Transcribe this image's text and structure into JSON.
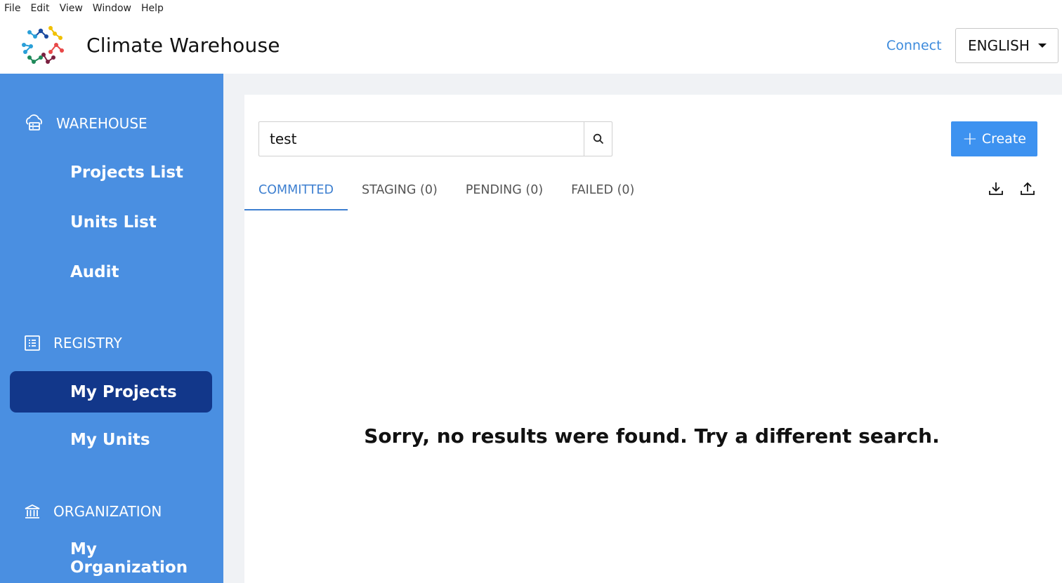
{
  "menubar": {
    "file": "File",
    "edit": "Edit",
    "view": "View",
    "window": "Window",
    "help": "Help"
  },
  "header": {
    "title": "Climate Warehouse",
    "connect_label": "Connect",
    "language": "ENGLISH"
  },
  "sidebar": {
    "warehouse": {
      "label": "WAREHOUSE",
      "items": [
        "Projects List",
        "Units List",
        "Audit"
      ]
    },
    "registry": {
      "label": "REGISTRY",
      "items": [
        "My Projects",
        "My Units"
      ],
      "active": "My Projects"
    },
    "organization": {
      "label": "ORGANIZATION",
      "items": [
        "My Organization"
      ]
    }
  },
  "main": {
    "search_value": "test",
    "create_label": "Create",
    "tabs": [
      {
        "label": "COMMITTED",
        "active": true
      },
      {
        "label": "STAGING (0)",
        "active": false
      },
      {
        "label": "PENDING (0)",
        "active": false
      },
      {
        "label": "FAILED (0)",
        "active": false
      }
    ],
    "empty_message": "Sorry, no results were found. Try a different search."
  },
  "colors": {
    "sidebar": "#4a8fe1",
    "sidebar_active": "#12378a",
    "accent": "#3d92f0",
    "tab_active": "#3d7fd0"
  }
}
